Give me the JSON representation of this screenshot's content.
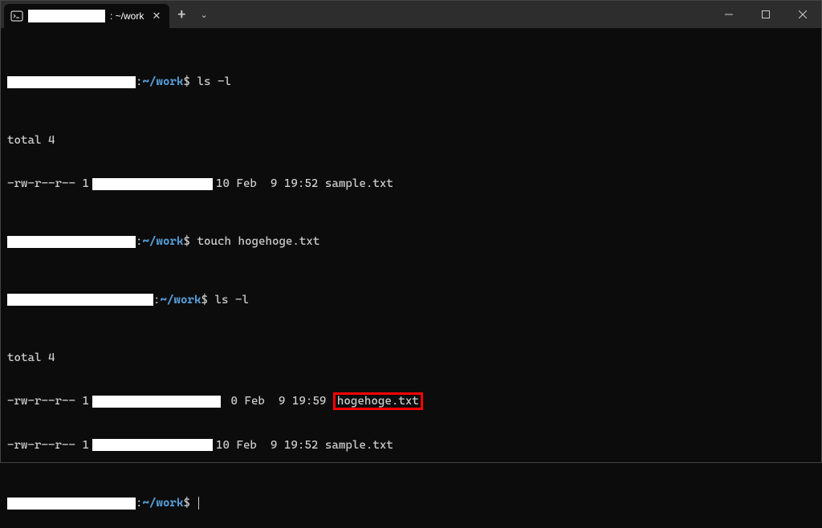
{
  "titlebar": {
    "tab_label_suffix": ": ~/work",
    "close_glyph": "✕",
    "add_glyph": "+",
    "dropdown_glyph": "⌄"
  },
  "prompts": [
    {
      "path": "~/work",
      "dollar": "$",
      "command": "ls -l"
    }
  ],
  "ls1": {
    "total": "total 4",
    "row": {
      "perm": "-rw-r--r-- 1",
      "size": "10 Feb  9 19:52 sample.txt"
    }
  },
  "prompt2": {
    "path": "~/work",
    "dollar": "$",
    "command": "touch hogehoge.txt"
  },
  "prompt3": {
    "path": "~/work",
    "dollar": "$",
    "command": "ls -l"
  },
  "ls2": {
    "total": "total 4",
    "row1": {
      "perm": "-rw-r--r-- 1",
      "size": " 0 Feb  9 19:59 ",
      "fname": "hogehoge.txt"
    },
    "row2": {
      "perm": "-rw-r--r-- 1",
      "size": "10 Feb  9 19:52 sample.txt"
    }
  },
  "prompt4": {
    "path": "~/work",
    "dollar": "$",
    "command": ""
  }
}
